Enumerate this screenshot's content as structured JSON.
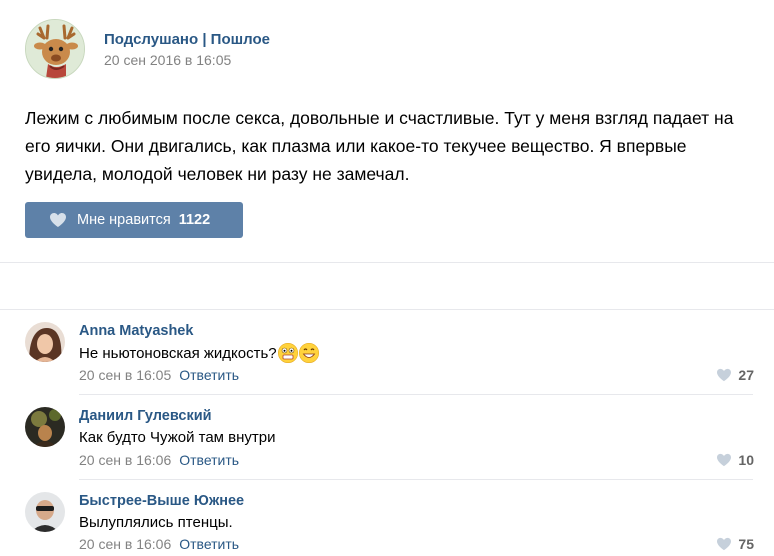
{
  "post": {
    "author": "Подслушано | Пошлое",
    "date": "20 сен 2016 в 16:05",
    "text": "Лежим с любимым после секса, довольные и счастливые. Тут у меня взгляд падает на его яички. Они двигались, как плазма или какое-то текучее вещество. Я впервые увидела, молодой человек ни разу не замечал.",
    "like_label": "Мне нравится",
    "like_count": "1122"
  },
  "comments": [
    {
      "author": "Anna Matyashek",
      "text": "Не ньютоновская жидкость?",
      "date": "20 сен в 16:05",
      "reply": "Ответить",
      "likes": "27"
    },
    {
      "author": "Даниил Гулевский",
      "text": "Как будто Чужой там внутри",
      "date": "20 сен в 16:06",
      "reply": "Ответить",
      "likes": "10"
    },
    {
      "author": "Быстрее-Выше Южнее",
      "text": "Вылуплялись птенцы.",
      "date": "20 сен в 16:06",
      "reply": "Ответить",
      "likes": "75"
    }
  ],
  "colors": {
    "link": "#2a5885",
    "like_button": "#5e81a8",
    "muted": "#828282",
    "divider": "#e7e8ec"
  },
  "icons": [
    "heart-icon",
    "deer-avatar",
    "emoji-surprised",
    "emoji-grin"
  ]
}
